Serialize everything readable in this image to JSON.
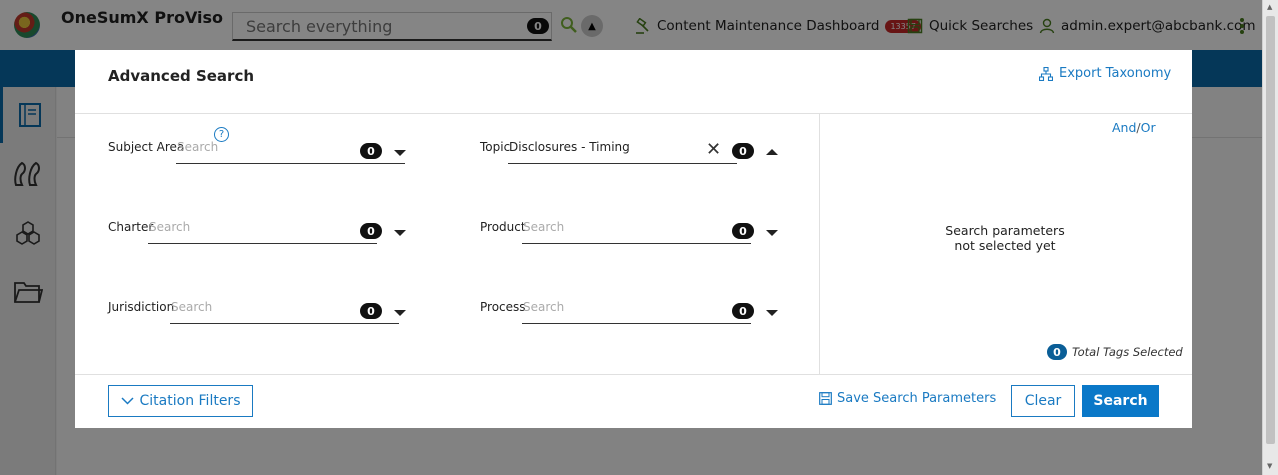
{
  "header": {
    "app_title": "OneSumX ProViso",
    "search_placeholder": "Search everything",
    "search_count": "0",
    "nav": {
      "dashboard_label": "Content Maintenance Dashboard",
      "dashboard_badge": "13357",
      "quick_searches_label": "Quick Searches",
      "user_label": "admin.expert@abcbank.com"
    }
  },
  "sidebar": {
    "items": [
      {
        "icon": "book-icon"
      },
      {
        "icon": "quote-icon"
      },
      {
        "icon": "cubes-icon"
      },
      {
        "icon": "folder-icon"
      }
    ]
  },
  "modal": {
    "title": "Advanced Search",
    "export_label": "Export Taxonomy",
    "fields": {
      "subject_area": {
        "label": "Subject Area",
        "placeholder": "Search",
        "count": "0",
        "help": "?"
      },
      "topic": {
        "label": "Topic",
        "value": "Disclosures - Timing",
        "count": "0"
      },
      "charter": {
        "label": "Charter",
        "placeholder": "Search",
        "count": "0"
      },
      "product": {
        "label": "Product",
        "placeholder": "Search",
        "count": "0"
      },
      "jurisdiction": {
        "label": "Jurisdiction",
        "placeholder": "Search",
        "count": "0"
      },
      "process": {
        "label": "Process",
        "placeholder": "Search",
        "count": "0"
      }
    },
    "right_panel": {
      "and_label": "And",
      "slash": "/",
      "or_label": "Or",
      "empty_line1": "Search parameters",
      "empty_line2": "not selected yet",
      "total_count": "0",
      "total_label": "Total Tags Selected"
    },
    "footer": {
      "citation_filters_label": "Citation Filters",
      "save_params_label": "Save Search Parameters",
      "clear_label": "Clear",
      "search_label": "Search"
    }
  },
  "colors": {
    "brand_blue": "#0a6aaa",
    "link_blue": "#1a7ac2",
    "badge_red": "#c62828"
  }
}
